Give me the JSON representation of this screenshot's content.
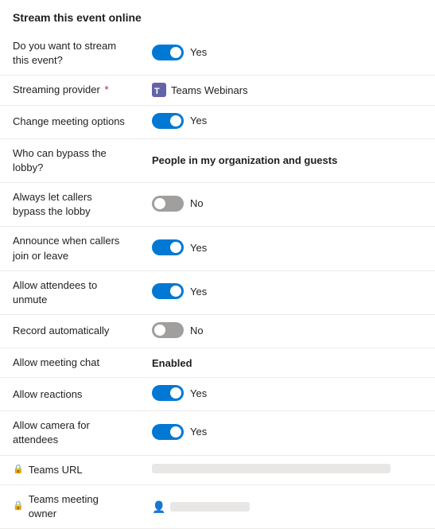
{
  "page": {
    "title": "Stream this event online"
  },
  "rows": [
    {
      "id": "stream-event",
      "label": "Do you want to stream this event?",
      "type": "toggle",
      "toggle_state": "on",
      "value_text": "Yes",
      "required": false,
      "has_lock": false
    },
    {
      "id": "streaming-provider",
      "label": "Streaming provider",
      "type": "provider",
      "provider_name": "Teams Webinars",
      "required": true,
      "has_lock": false
    },
    {
      "id": "change-meeting-options",
      "label": "Change meeting options",
      "type": "toggle",
      "toggle_state": "on",
      "value_text": "Yes",
      "required": false,
      "has_lock": false
    },
    {
      "id": "bypass-lobby",
      "label": "Who can bypass the lobby?",
      "type": "text-bold",
      "value_text": "People in my organization and guests",
      "required": false,
      "has_lock": false
    },
    {
      "id": "callers-bypass",
      "label": "Always let callers bypass the lobby",
      "type": "toggle",
      "toggle_state": "off",
      "value_text": "No",
      "required": false,
      "has_lock": false
    },
    {
      "id": "announce-callers",
      "label": "Announce when callers join or leave",
      "type": "toggle",
      "toggle_state": "on",
      "value_text": "Yes",
      "required": false,
      "has_lock": false
    },
    {
      "id": "allow-unmute",
      "label": "Allow attendees to unmute",
      "type": "toggle",
      "toggle_state": "on",
      "value_text": "Yes",
      "required": false,
      "has_lock": false
    },
    {
      "id": "record-auto",
      "label": "Record automatically",
      "type": "toggle",
      "toggle_state": "off",
      "value_text": "No",
      "required": false,
      "has_lock": false
    },
    {
      "id": "meeting-chat",
      "label": "Allow meeting chat",
      "type": "text-bold",
      "value_text": "Enabled",
      "required": false,
      "has_lock": false
    },
    {
      "id": "reactions",
      "label": "Allow reactions",
      "type": "toggle",
      "toggle_state": "on",
      "value_text": "Yes",
      "required": false,
      "has_lock": false
    },
    {
      "id": "camera-attendees",
      "label": "Allow camera for attendees",
      "type": "toggle",
      "toggle_state": "on",
      "value_text": "Yes",
      "required": false,
      "has_lock": false
    },
    {
      "id": "teams-url",
      "label": "Teams URL",
      "type": "url",
      "required": false,
      "has_lock": true
    },
    {
      "id": "teams-owner",
      "label": "Teams meeting owner",
      "type": "owner",
      "required": false,
      "has_lock": true
    }
  ],
  "labels": {
    "yes": "Yes",
    "no": "No",
    "teams_webinars": "Teams Webinars",
    "people_org": "People in my organization and guests",
    "enabled": "Enabled"
  }
}
